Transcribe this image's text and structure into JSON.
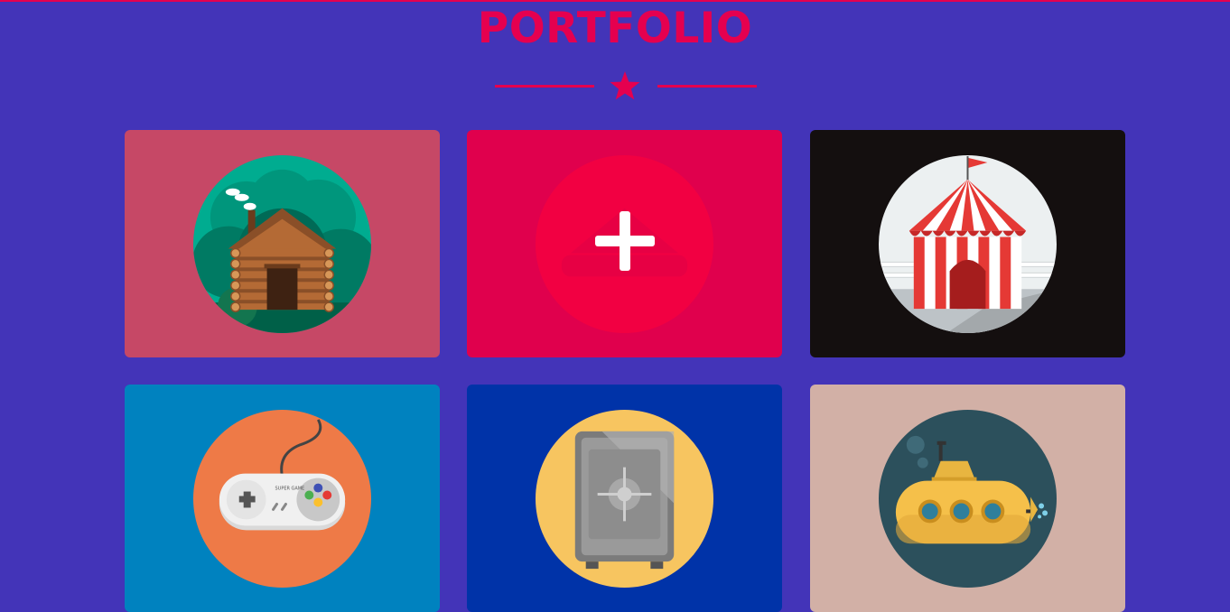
{
  "section": {
    "title": "PORTFOLIO"
  },
  "icons": {
    "divider": "star-icon",
    "hover": "plus-icon"
  },
  "colors": {
    "background": "#4334b8",
    "accent": "#e5004f"
  },
  "portfolio": {
    "items": [
      {
        "icon": "log-cabin-icon",
        "background": "#c64866"
      },
      {
        "icon": "boat-icon",
        "background": "#e0004d",
        "hovered": true
      },
      {
        "icon": "circus-tent-icon",
        "background": "#140f0f"
      },
      {
        "icon": "gamepad-icon",
        "background": "#0082bf"
      },
      {
        "icon": "safe-icon",
        "background": "#0033a8"
      },
      {
        "icon": "submarine-icon",
        "background": "#d2b0a6"
      }
    ],
    "gamepad_text": "SUPER GAME"
  }
}
